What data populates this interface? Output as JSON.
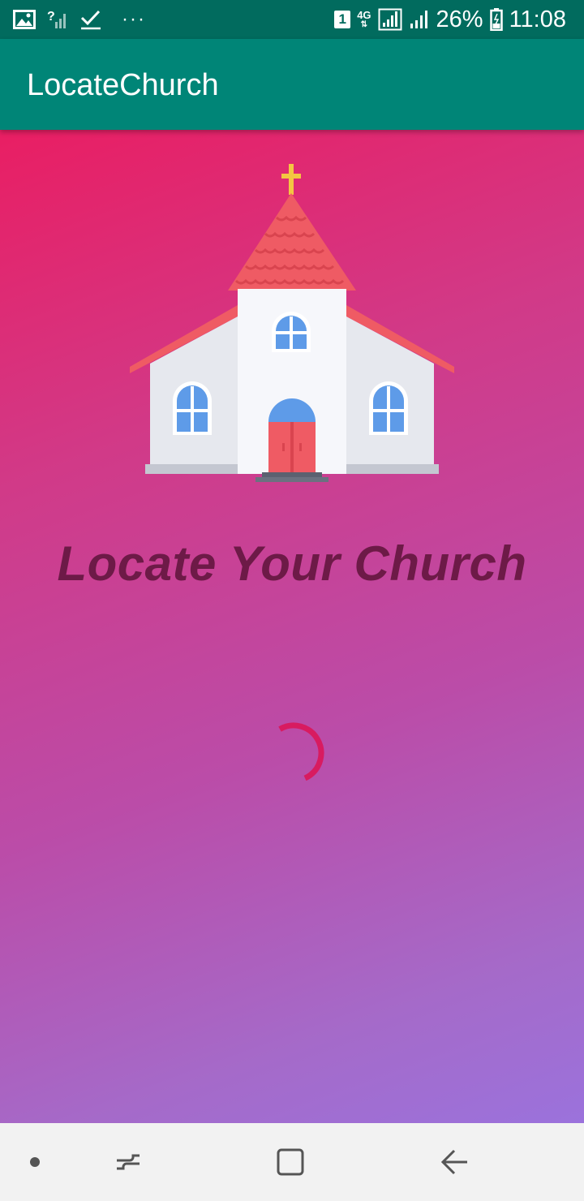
{
  "status_bar": {
    "sim_slot": "1",
    "network_type": "4G",
    "battery_percent": "26%",
    "time": "11:08",
    "overflow_dots": "···",
    "icons": [
      "gallery-icon",
      "no-signal-icon",
      "check-icon",
      "sim-icon",
      "signal-icon",
      "battery-icon"
    ]
  },
  "app_bar": {
    "title": "LocateChurch"
  },
  "main": {
    "headline": "Locate Your Church",
    "illustration": "church-icon",
    "loading": true
  },
  "nav_bar": {
    "items": [
      "nav-dot-icon",
      "recent-apps-icon",
      "home-icon",
      "back-icon"
    ]
  },
  "colors": {
    "status_bar": "#016b5e",
    "app_bar": "#008577",
    "gradient_start": "#e91e63",
    "gradient_end": "#9b72dc",
    "headline": "#6d1a47",
    "spinner": "#d81b60"
  }
}
